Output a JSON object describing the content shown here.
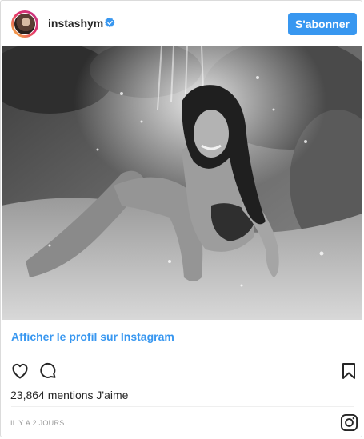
{
  "header": {
    "username": "instashym",
    "verified_icon": "verified-badge-icon",
    "follow_label": "S'abonner"
  },
  "profile_link": "Afficher le profil sur Instagram",
  "actions": {
    "like_icon": "heart-icon",
    "comment_icon": "comment-icon",
    "save_icon": "bookmark-icon"
  },
  "likes_text": "23,864 mentions J'aime",
  "timestamp": "IL Y A 2 JOURS",
  "footer_icon": "instagram-logo-icon",
  "colors": {
    "accent": "#3897f0",
    "text": "#262626",
    "muted": "#999999",
    "border": "#dbdbdb"
  }
}
